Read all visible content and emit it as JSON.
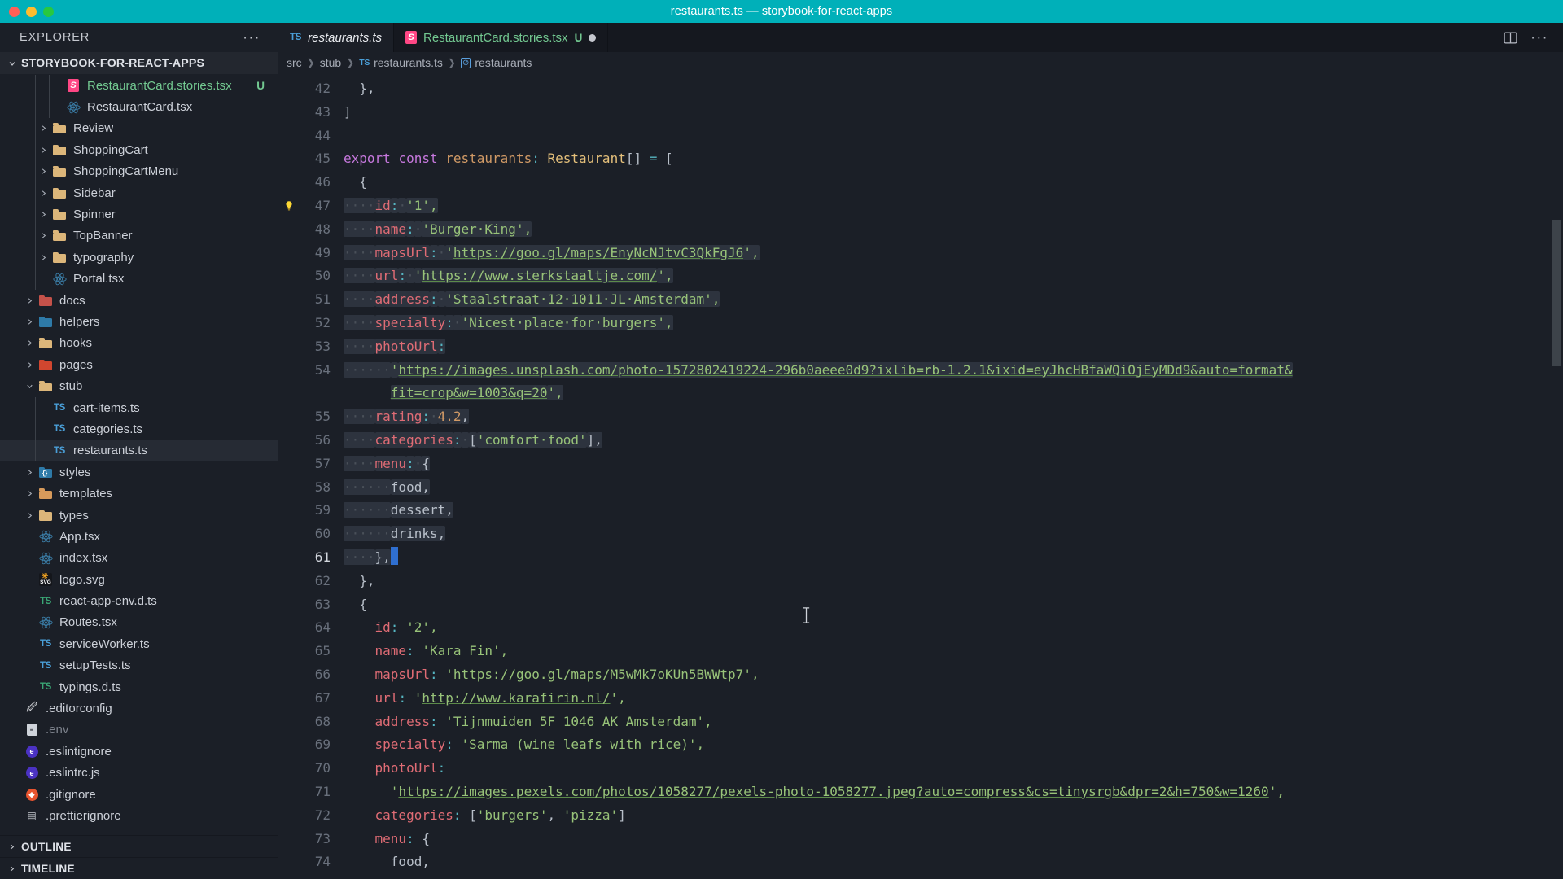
{
  "window": {
    "title": "restaurants.ts — storybook-for-react-apps",
    "accent_color": "#00b0b9",
    "traffic_lights": [
      "close",
      "minimize",
      "zoom"
    ]
  },
  "sidebar": {
    "header_label": "EXPLORER",
    "more_actions": "···",
    "project": {
      "label": "STORYBOOK-FOR-REACT-APPS",
      "expanded": true
    },
    "items": [
      {
        "label": "RestaurantCard.stories.tsx",
        "icon": "storybook-icon",
        "indent": 3,
        "twisty": "",
        "badge": "U",
        "modified": true
      },
      {
        "label": "RestaurantCard.tsx",
        "icon": "react-icon",
        "indent": 3,
        "twisty": "",
        "badge": ""
      },
      {
        "label": "Review",
        "icon": "folder-icon",
        "indent": 2,
        "twisty": "chevron-right"
      },
      {
        "label": "ShoppingCart",
        "icon": "folder-icon",
        "indent": 2,
        "twisty": "chevron-right"
      },
      {
        "label": "ShoppingCartMenu",
        "icon": "folder-icon",
        "indent": 2,
        "twisty": "chevron-right"
      },
      {
        "label": "Sidebar",
        "icon": "folder-icon",
        "indent": 2,
        "twisty": "chevron-right"
      },
      {
        "label": "Spinner",
        "icon": "folder-icon",
        "indent": 2,
        "twisty": "chevron-right"
      },
      {
        "label": "TopBanner",
        "icon": "folder-icon",
        "indent": 2,
        "twisty": "chevron-right"
      },
      {
        "label": "typography",
        "icon": "folder-icon",
        "indent": 2,
        "twisty": "chevron-right"
      },
      {
        "label": "Portal.tsx",
        "icon": "react-icon",
        "indent": 2,
        "twisty": ""
      },
      {
        "label": "docs",
        "icon": "folder-docs-icon",
        "indent": 1,
        "twisty": "chevron-right"
      },
      {
        "label": "helpers",
        "icon": "folder-helpers-icon",
        "indent": 1,
        "twisty": "chevron-right"
      },
      {
        "label": "hooks",
        "icon": "folder-hooks-icon",
        "indent": 1,
        "twisty": "chevron-right"
      },
      {
        "label": "pages",
        "icon": "folder-pages-icon",
        "indent": 1,
        "twisty": "chevron-right"
      },
      {
        "label": "stub",
        "icon": "folder-open-icon",
        "indent": 1,
        "twisty": "chevron-down"
      },
      {
        "label": "cart-items.ts",
        "icon": "typescript-icon",
        "indent": 2,
        "twisty": ""
      },
      {
        "label": "categories.ts",
        "icon": "typescript-icon",
        "indent": 2,
        "twisty": ""
      },
      {
        "label": "restaurants.ts",
        "icon": "typescript-icon",
        "indent": 2,
        "twisty": "",
        "selected": true
      },
      {
        "label": "styles",
        "icon": "folder-styles-icon",
        "indent": 1,
        "twisty": "chevron-right"
      },
      {
        "label": "templates",
        "icon": "folder-templates-icon",
        "indent": 1,
        "twisty": "chevron-right"
      },
      {
        "label": "types",
        "icon": "folder-icon",
        "indent": 1,
        "twisty": "chevron-right"
      },
      {
        "label": "App.tsx",
        "icon": "react-icon",
        "indent": 1,
        "twisty": ""
      },
      {
        "label": "index.tsx",
        "icon": "react-icon",
        "indent": 1,
        "twisty": ""
      },
      {
        "label": "logo.svg",
        "icon": "svg-icon",
        "indent": 1,
        "twisty": ""
      },
      {
        "label": "react-app-env.d.ts",
        "icon": "typescript-def-icon",
        "indent": 1,
        "twisty": ""
      },
      {
        "label": "Routes.tsx",
        "icon": "react-icon",
        "indent": 1,
        "twisty": ""
      },
      {
        "label": "serviceWorker.ts",
        "icon": "typescript-icon",
        "indent": 1,
        "twisty": ""
      },
      {
        "label": "setupTests.ts",
        "icon": "typescript-icon",
        "indent": 1,
        "twisty": ""
      },
      {
        "label": "typings.d.ts",
        "icon": "typescript-def-icon",
        "indent": 1,
        "twisty": ""
      },
      {
        "label": ".editorconfig",
        "icon": "editorconfig-icon",
        "indent": 0,
        "twisty": ""
      },
      {
        "label": ".env",
        "icon": "env-icon",
        "indent": 0,
        "twisty": "",
        "dimmed": true
      },
      {
        "label": ".eslintignore",
        "icon": "eslint-icon",
        "indent": 0,
        "twisty": ""
      },
      {
        "label": ".eslintrc.js",
        "icon": "eslint-icon",
        "indent": 0,
        "twisty": ""
      },
      {
        "label": ".gitignore",
        "icon": "git-icon",
        "indent": 0,
        "twisty": ""
      },
      {
        "label": ".prettierignore",
        "icon": "prettier-icon",
        "indent": 0,
        "twisty": ""
      }
    ],
    "panels": [
      {
        "label": "OUTLINE",
        "collapsed": true
      },
      {
        "label": "TIMELINE",
        "collapsed": true
      }
    ]
  },
  "tabs": [
    {
      "label": "restaurants.ts",
      "icon": "typescript-icon",
      "active": true,
      "badge": "",
      "dirty": false
    },
    {
      "label": "RestaurantCard.stories.tsx",
      "icon": "storybook-icon",
      "active": false,
      "badge": "U",
      "dirty": true
    }
  ],
  "editor_actions": [
    "split-editor-icon",
    "more-actions-icon"
  ],
  "breadcrumb": [
    {
      "label": "src",
      "icon": ""
    },
    {
      "label": "stub",
      "icon": ""
    },
    {
      "label": "restaurants.ts",
      "icon": "typescript-icon"
    },
    {
      "label": "restaurants",
      "icon": "symbol-variable-icon"
    }
  ],
  "code": {
    "first_line": 42,
    "current_line": 61,
    "lines": [
      {
        "n": 42,
        "tokens": [
          {
            "t": "  ",
            "c": "ws"
          },
          {
            "t": "},",
            "c": "t-punc"
          }
        ]
      },
      {
        "n": 43,
        "tokens": [
          {
            "t": "]",
            "c": "t-punc"
          }
        ]
      },
      {
        "n": 44,
        "tokens": []
      },
      {
        "n": 45,
        "tokens": [
          {
            "t": "export",
            "c": "t-kw"
          },
          {
            "t": " ",
            "c": "t-plain"
          },
          {
            "t": "const",
            "c": "t-kw"
          },
          {
            "t": " ",
            "c": "t-plain"
          },
          {
            "t": "restaurants",
            "c": "t-var"
          },
          {
            "t": ":",
            "c": "t-colon"
          },
          {
            "t": " ",
            "c": "t-plain"
          },
          {
            "t": "Restaurant",
            "c": "t-type"
          },
          {
            "t": "[]",
            "c": "t-punc"
          },
          {
            "t": " ",
            "c": "t-plain"
          },
          {
            "t": "=",
            "c": "t-colon"
          },
          {
            "t": " ",
            "c": "t-plain"
          },
          {
            "t": "[",
            "c": "t-punc"
          }
        ]
      },
      {
        "n": 46,
        "tokens": [
          {
            "t": "  ",
            "c": "ws"
          },
          {
            "t": "{",
            "c": "t-punc"
          }
        ]
      },
      {
        "n": 47,
        "bulb": true,
        "sel": true,
        "tokens": [
          {
            "t": "····",
            "c": "ws"
          },
          {
            "t": "id",
            "c": "t-key"
          },
          {
            "t": ":",
            "c": "t-colon"
          },
          {
            "t": "·",
            "c": "ws"
          },
          {
            "t": "'1',",
            "c": "t-str"
          }
        ]
      },
      {
        "n": 48,
        "sel": true,
        "tokens": [
          {
            "t": "····",
            "c": "ws"
          },
          {
            "t": "name",
            "c": "t-key"
          },
          {
            "t": ":",
            "c": "t-colon"
          },
          {
            "t": "·",
            "c": "ws"
          },
          {
            "t": "'Burger·King',",
            "c": "t-str"
          }
        ]
      },
      {
        "n": 49,
        "sel": true,
        "tokens": [
          {
            "t": "····",
            "c": "ws"
          },
          {
            "t": "mapsUrl",
            "c": "t-key"
          },
          {
            "t": ":",
            "c": "t-colon"
          },
          {
            "t": "·",
            "c": "ws"
          },
          {
            "t": "'",
            "c": "t-str"
          },
          {
            "t": "https://goo.gl/maps/EnyNcNJtvC3QkFgJ6",
            "c": "t-link"
          },
          {
            "t": "',",
            "c": "t-str"
          }
        ]
      },
      {
        "n": 50,
        "sel": true,
        "tokens": [
          {
            "t": "····",
            "c": "ws"
          },
          {
            "t": "url",
            "c": "t-key"
          },
          {
            "t": ":",
            "c": "t-colon"
          },
          {
            "t": "·",
            "c": "ws"
          },
          {
            "t": "'",
            "c": "t-str"
          },
          {
            "t": "https://www.sterkstaaltje.com/",
            "c": "t-link"
          },
          {
            "t": "',",
            "c": "t-str"
          }
        ]
      },
      {
        "n": 51,
        "sel": true,
        "tokens": [
          {
            "t": "····",
            "c": "ws"
          },
          {
            "t": "address",
            "c": "t-key"
          },
          {
            "t": ":",
            "c": "t-colon"
          },
          {
            "t": "·",
            "c": "ws"
          },
          {
            "t": "'Staalstraat·12·1011·JL·Amsterdam',",
            "c": "t-str"
          }
        ]
      },
      {
        "n": 52,
        "sel": true,
        "tokens": [
          {
            "t": "····",
            "c": "ws"
          },
          {
            "t": "specialty",
            "c": "t-key"
          },
          {
            "t": ":",
            "c": "t-colon"
          },
          {
            "t": "·",
            "c": "ws"
          },
          {
            "t": "'Nicest·place·for·burgers',",
            "c": "t-str"
          }
        ]
      },
      {
        "n": 53,
        "sel": true,
        "tokens": [
          {
            "t": "····",
            "c": "ws"
          },
          {
            "t": "photoUrl",
            "c": "t-key"
          },
          {
            "t": ":",
            "c": "t-colon"
          }
        ]
      },
      {
        "n": 54,
        "sel": true,
        "wrapped": true,
        "tokens": [
          {
            "t": "······",
            "c": "ws"
          },
          {
            "t": "'",
            "c": "t-str"
          },
          {
            "t": "https://images.unsplash.com/photo-1572802419224-296b0aeee0d9?ixlib=rb-1.2.1&ixid=eyJhcHBfaWQiOjEyMDd9&auto=format&",
            "c": "t-link"
          }
        ],
        "cont": [
          {
            "t": "fit=crop&w=1003&q=20",
            "c": "t-link"
          },
          {
            "t": "',",
            "c": "t-str"
          }
        ]
      },
      {
        "n": 55,
        "sel": true,
        "tokens": [
          {
            "t": "····",
            "c": "ws"
          },
          {
            "t": "rating",
            "c": "t-key"
          },
          {
            "t": ":",
            "c": "t-colon"
          },
          {
            "t": "·",
            "c": "ws"
          },
          {
            "t": "4.2",
            "c": "t-num"
          },
          {
            "t": ",",
            "c": "t-punc"
          }
        ]
      },
      {
        "n": 56,
        "sel": true,
        "tokens": [
          {
            "t": "····",
            "c": "ws"
          },
          {
            "t": "categories",
            "c": "t-key"
          },
          {
            "t": ":",
            "c": "t-colon"
          },
          {
            "t": "·",
            "c": "ws"
          },
          {
            "t": "[",
            "c": "t-punc"
          },
          {
            "t": "'comfort·food'",
            "c": "t-str"
          },
          {
            "t": "],",
            "c": "t-punc"
          }
        ]
      },
      {
        "n": 57,
        "sel": true,
        "tokens": [
          {
            "t": "····",
            "c": "ws"
          },
          {
            "t": "menu",
            "c": "t-key"
          },
          {
            "t": ":",
            "c": "t-colon"
          },
          {
            "t": "·",
            "c": "ws"
          },
          {
            "t": "{",
            "c": "t-punc"
          }
        ]
      },
      {
        "n": 58,
        "sel": true,
        "tokens": [
          {
            "t": "······",
            "c": "ws"
          },
          {
            "t": "food,",
            "c": "t-plain"
          }
        ]
      },
      {
        "n": 59,
        "sel": true,
        "tokens": [
          {
            "t": "······",
            "c": "ws"
          },
          {
            "t": "dessert,",
            "c": "t-plain"
          }
        ]
      },
      {
        "n": 60,
        "sel": true,
        "tokens": [
          {
            "t": "······",
            "c": "ws"
          },
          {
            "t": "drinks,",
            "c": "t-plain"
          }
        ]
      },
      {
        "n": 61,
        "sel": true,
        "cursor": true,
        "current": true,
        "tokens": [
          {
            "t": "····",
            "c": "ws"
          },
          {
            "t": "},",
            "c": "t-punc"
          }
        ]
      },
      {
        "n": 62,
        "tokens": [
          {
            "t": "  ",
            "c": "ws"
          },
          {
            "t": "},",
            "c": "t-punc"
          }
        ]
      },
      {
        "n": 63,
        "tokens": [
          {
            "t": "  ",
            "c": "ws"
          },
          {
            "t": "{",
            "c": "t-punc"
          }
        ]
      },
      {
        "n": 64,
        "tokens": [
          {
            "t": "    ",
            "c": "ws"
          },
          {
            "t": "id",
            "c": "t-key"
          },
          {
            "t": ":",
            "c": "t-colon"
          },
          {
            "t": " ",
            "c": "ws"
          },
          {
            "t": "'2',",
            "c": "t-str"
          }
        ]
      },
      {
        "n": 65,
        "tokens": [
          {
            "t": "    ",
            "c": "ws"
          },
          {
            "t": "name",
            "c": "t-key"
          },
          {
            "t": ":",
            "c": "t-colon"
          },
          {
            "t": " ",
            "c": "ws"
          },
          {
            "t": "'Kara Fin',",
            "c": "t-str"
          }
        ]
      },
      {
        "n": 66,
        "tokens": [
          {
            "t": "    ",
            "c": "ws"
          },
          {
            "t": "mapsUrl",
            "c": "t-key"
          },
          {
            "t": ":",
            "c": "t-colon"
          },
          {
            "t": " ",
            "c": "ws"
          },
          {
            "t": "'",
            "c": "t-str"
          },
          {
            "t": "https://goo.gl/maps/M5wMk7oKUn5BWWtp7",
            "c": "t-link"
          },
          {
            "t": "',",
            "c": "t-str"
          }
        ]
      },
      {
        "n": 67,
        "tokens": [
          {
            "t": "    ",
            "c": "ws"
          },
          {
            "t": "url",
            "c": "t-key"
          },
          {
            "t": ":",
            "c": "t-colon"
          },
          {
            "t": " ",
            "c": "ws"
          },
          {
            "t": "'",
            "c": "t-str"
          },
          {
            "t": "http://www.karafirin.nl/",
            "c": "t-link"
          },
          {
            "t": "',",
            "c": "t-str"
          }
        ]
      },
      {
        "n": 68,
        "tokens": [
          {
            "t": "    ",
            "c": "ws"
          },
          {
            "t": "address",
            "c": "t-key"
          },
          {
            "t": ":",
            "c": "t-colon"
          },
          {
            "t": " ",
            "c": "ws"
          },
          {
            "t": "'Tijnmuiden 5F 1046 AK Amsterdam',",
            "c": "t-str"
          }
        ]
      },
      {
        "n": 69,
        "tokens": [
          {
            "t": "    ",
            "c": "ws"
          },
          {
            "t": "specialty",
            "c": "t-key"
          },
          {
            "t": ":",
            "c": "t-colon"
          },
          {
            "t": " ",
            "c": "ws"
          },
          {
            "t": "'Sarma (wine leafs with rice)',",
            "c": "t-str"
          }
        ]
      },
      {
        "n": 70,
        "tokens": [
          {
            "t": "    ",
            "c": "ws"
          },
          {
            "t": "photoUrl",
            "c": "t-key"
          },
          {
            "t": ":",
            "c": "t-colon"
          }
        ]
      },
      {
        "n": 71,
        "tokens": [
          {
            "t": "      ",
            "c": "ws"
          },
          {
            "t": "'",
            "c": "t-str"
          },
          {
            "t": "https://images.pexels.com/photos/1058277/pexels-photo-1058277.jpeg?auto=compress&cs=tinysrgb&dpr=2&h=750&w=1260",
            "c": "t-link"
          },
          {
            "t": "',",
            "c": "t-str"
          }
        ]
      },
      {
        "n": 72,
        "tokens": [
          {
            "t": "    ",
            "c": "ws"
          },
          {
            "t": "categories",
            "c": "t-key"
          },
          {
            "t": ":",
            "c": "t-colon"
          },
          {
            "t": " ",
            "c": "ws"
          },
          {
            "t": "[",
            "c": "t-punc"
          },
          {
            "t": "'burgers'",
            "c": "t-str"
          },
          {
            "t": ", ",
            "c": "t-punc"
          },
          {
            "t": "'pizza'",
            "c": "t-str"
          },
          {
            "t": "]",
            "c": "t-punc"
          }
        ]
      },
      {
        "n": 73,
        "tokens": [
          {
            "t": "    ",
            "c": "ws"
          },
          {
            "t": "menu",
            "c": "t-key"
          },
          {
            "t": ":",
            "c": "t-colon"
          },
          {
            "t": " ",
            "c": "ws"
          },
          {
            "t": "{",
            "c": "t-punc"
          }
        ]
      },
      {
        "n": 74,
        "tokens": [
          {
            "t": "      ",
            "c": "ws"
          },
          {
            "t": "food,",
            "c": "t-plain"
          }
        ]
      }
    ]
  }
}
